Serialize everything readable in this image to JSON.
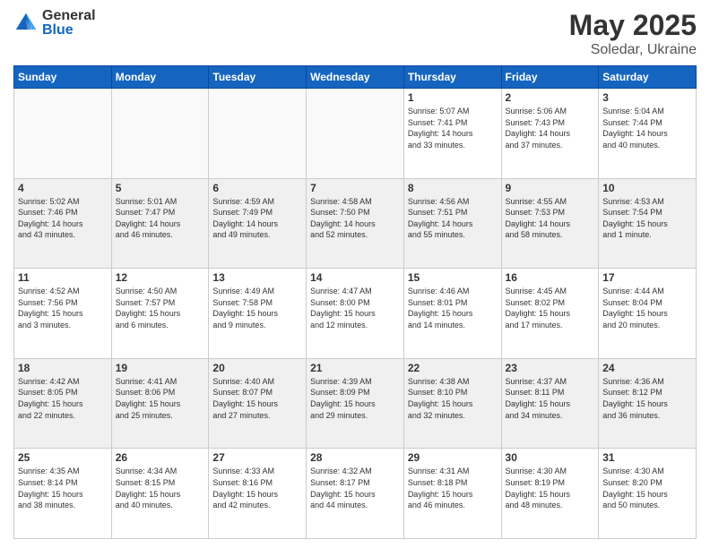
{
  "header": {
    "logo_general": "General",
    "logo_blue": "Blue",
    "title": "May 2025",
    "location": "Soledar, Ukraine"
  },
  "weekdays": [
    "Sunday",
    "Monday",
    "Tuesday",
    "Wednesday",
    "Thursday",
    "Friday",
    "Saturday"
  ],
  "weeks": [
    [
      {
        "day": "",
        "info": ""
      },
      {
        "day": "",
        "info": ""
      },
      {
        "day": "",
        "info": ""
      },
      {
        "day": "",
        "info": ""
      },
      {
        "day": "1",
        "info": "Sunrise: 5:07 AM\nSunset: 7:41 PM\nDaylight: 14 hours\nand 33 minutes."
      },
      {
        "day": "2",
        "info": "Sunrise: 5:06 AM\nSunset: 7:43 PM\nDaylight: 14 hours\nand 37 minutes."
      },
      {
        "day": "3",
        "info": "Sunrise: 5:04 AM\nSunset: 7:44 PM\nDaylight: 14 hours\nand 40 minutes."
      }
    ],
    [
      {
        "day": "4",
        "info": "Sunrise: 5:02 AM\nSunset: 7:46 PM\nDaylight: 14 hours\nand 43 minutes."
      },
      {
        "day": "5",
        "info": "Sunrise: 5:01 AM\nSunset: 7:47 PM\nDaylight: 14 hours\nand 46 minutes."
      },
      {
        "day": "6",
        "info": "Sunrise: 4:59 AM\nSunset: 7:49 PM\nDaylight: 14 hours\nand 49 minutes."
      },
      {
        "day": "7",
        "info": "Sunrise: 4:58 AM\nSunset: 7:50 PM\nDaylight: 14 hours\nand 52 minutes."
      },
      {
        "day": "8",
        "info": "Sunrise: 4:56 AM\nSunset: 7:51 PM\nDaylight: 14 hours\nand 55 minutes."
      },
      {
        "day": "9",
        "info": "Sunrise: 4:55 AM\nSunset: 7:53 PM\nDaylight: 14 hours\nand 58 minutes."
      },
      {
        "day": "10",
        "info": "Sunrise: 4:53 AM\nSunset: 7:54 PM\nDaylight: 15 hours\nand 1 minute."
      }
    ],
    [
      {
        "day": "11",
        "info": "Sunrise: 4:52 AM\nSunset: 7:56 PM\nDaylight: 15 hours\nand 3 minutes."
      },
      {
        "day": "12",
        "info": "Sunrise: 4:50 AM\nSunset: 7:57 PM\nDaylight: 15 hours\nand 6 minutes."
      },
      {
        "day": "13",
        "info": "Sunrise: 4:49 AM\nSunset: 7:58 PM\nDaylight: 15 hours\nand 9 minutes."
      },
      {
        "day": "14",
        "info": "Sunrise: 4:47 AM\nSunset: 8:00 PM\nDaylight: 15 hours\nand 12 minutes."
      },
      {
        "day": "15",
        "info": "Sunrise: 4:46 AM\nSunset: 8:01 PM\nDaylight: 15 hours\nand 14 minutes."
      },
      {
        "day": "16",
        "info": "Sunrise: 4:45 AM\nSunset: 8:02 PM\nDaylight: 15 hours\nand 17 minutes."
      },
      {
        "day": "17",
        "info": "Sunrise: 4:44 AM\nSunset: 8:04 PM\nDaylight: 15 hours\nand 20 minutes."
      }
    ],
    [
      {
        "day": "18",
        "info": "Sunrise: 4:42 AM\nSunset: 8:05 PM\nDaylight: 15 hours\nand 22 minutes."
      },
      {
        "day": "19",
        "info": "Sunrise: 4:41 AM\nSunset: 8:06 PM\nDaylight: 15 hours\nand 25 minutes."
      },
      {
        "day": "20",
        "info": "Sunrise: 4:40 AM\nSunset: 8:07 PM\nDaylight: 15 hours\nand 27 minutes."
      },
      {
        "day": "21",
        "info": "Sunrise: 4:39 AM\nSunset: 8:09 PM\nDaylight: 15 hours\nand 29 minutes."
      },
      {
        "day": "22",
        "info": "Sunrise: 4:38 AM\nSunset: 8:10 PM\nDaylight: 15 hours\nand 32 minutes."
      },
      {
        "day": "23",
        "info": "Sunrise: 4:37 AM\nSunset: 8:11 PM\nDaylight: 15 hours\nand 34 minutes."
      },
      {
        "day": "24",
        "info": "Sunrise: 4:36 AM\nSunset: 8:12 PM\nDaylight: 15 hours\nand 36 minutes."
      }
    ],
    [
      {
        "day": "25",
        "info": "Sunrise: 4:35 AM\nSunset: 8:14 PM\nDaylight: 15 hours\nand 38 minutes."
      },
      {
        "day": "26",
        "info": "Sunrise: 4:34 AM\nSunset: 8:15 PM\nDaylight: 15 hours\nand 40 minutes."
      },
      {
        "day": "27",
        "info": "Sunrise: 4:33 AM\nSunset: 8:16 PM\nDaylight: 15 hours\nand 42 minutes."
      },
      {
        "day": "28",
        "info": "Sunrise: 4:32 AM\nSunset: 8:17 PM\nDaylight: 15 hours\nand 44 minutes."
      },
      {
        "day": "29",
        "info": "Sunrise: 4:31 AM\nSunset: 8:18 PM\nDaylight: 15 hours\nand 46 minutes."
      },
      {
        "day": "30",
        "info": "Sunrise: 4:30 AM\nSunset: 8:19 PM\nDaylight: 15 hours\nand 48 minutes."
      },
      {
        "day": "31",
        "info": "Sunrise: 4:30 AM\nSunset: 8:20 PM\nDaylight: 15 hours\nand 50 minutes."
      }
    ]
  ]
}
